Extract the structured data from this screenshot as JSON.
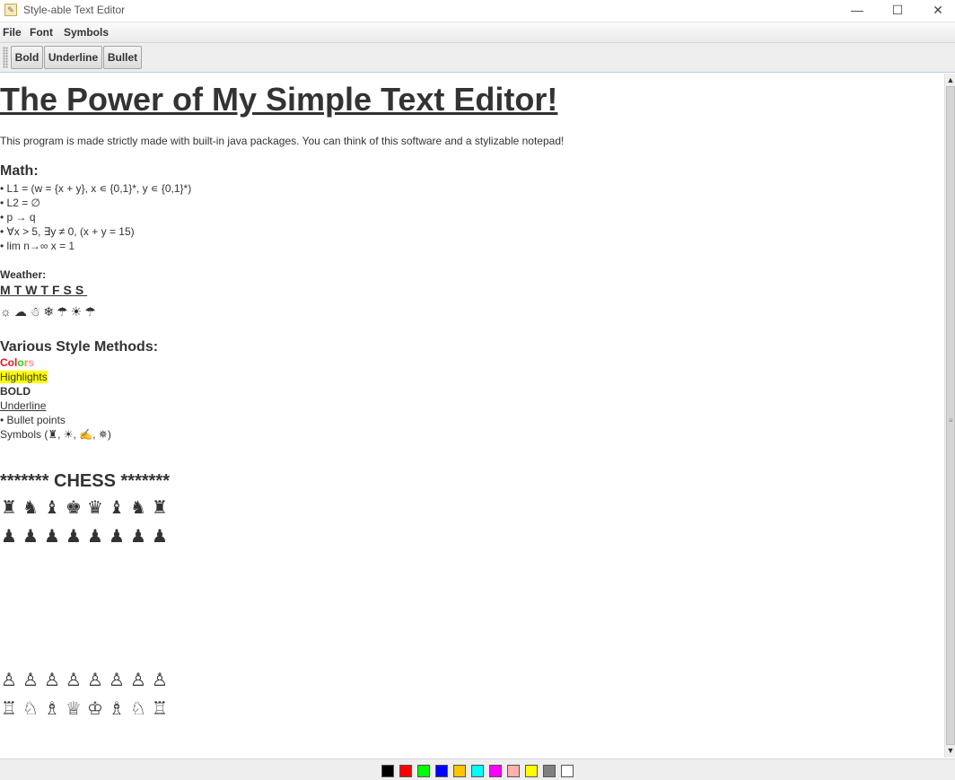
{
  "window": {
    "title": "Style-able Text Editor",
    "minimize": "—",
    "maximize": "☐",
    "close": "✕"
  },
  "menu": [
    "File",
    "Font",
    "Symbols"
  ],
  "toolbar": {
    "bold": "Bold",
    "underline": "Underline",
    "bullet": "Bullet"
  },
  "document": {
    "title": "The Power of My Simple Text Editor!",
    "intro": "This program is made strictly made with built-in java packages. You can think of this software and a stylizable notepad!",
    "math_heading": "Math:",
    "math_lines": [
      "• L1 = (w = {x + y}, x ∊ {0,1}*, y ∊ {0,1}*)",
      "• L2 = ∅",
      "• p → q",
      "• ∀x > 5, ∃y ≠ 0, (x + y = 15)",
      "• lim n→∞ x = 1"
    ],
    "weather_heading": "Weather:",
    "weekdays": "MTWTFSS",
    "weather_icons": "☼☁☃❄☂☀☂",
    "styles_heading": "Various Style Methods:",
    "colors_parts": [
      "Co",
      "l",
      "o",
      "r",
      "s"
    ],
    "highlights": "Highlights",
    "bold": "BOLD",
    "underline": "Underline",
    "bullet": "• Bullet points",
    "symbols": "Symbols (♜, ☀, ✍, ✵)",
    "chess_heading": "******* CHESS *******",
    "black_back": [
      "♜",
      "♞",
      "♝",
      "♚",
      "♛",
      "♝",
      "♞",
      "♜"
    ],
    "black_pawns": [
      "♟",
      "♟",
      "♟",
      "♟",
      "♟",
      "♟",
      "♟",
      "♟"
    ],
    "white_pawns": [
      "♙",
      "♙",
      "♙",
      "♙",
      "♙",
      "♙",
      "♙",
      "♙"
    ],
    "white_back": [
      "♖",
      "♘",
      "♗",
      "♕",
      "♔",
      "♗",
      "♘",
      "♖"
    ]
  },
  "colors_text_colors": [
    "#e8141b",
    "#e8141b",
    "#28c528",
    "#ff8c1a",
    "#ff8fb0"
  ],
  "palette": [
    "#000000",
    "#ff0000",
    "#00ff00",
    "#0000ff",
    "#ffc400",
    "#00ffff",
    "#ff00ff",
    "#ffafaf",
    "#ffff00",
    "#808080",
    "#ffffff"
  ]
}
